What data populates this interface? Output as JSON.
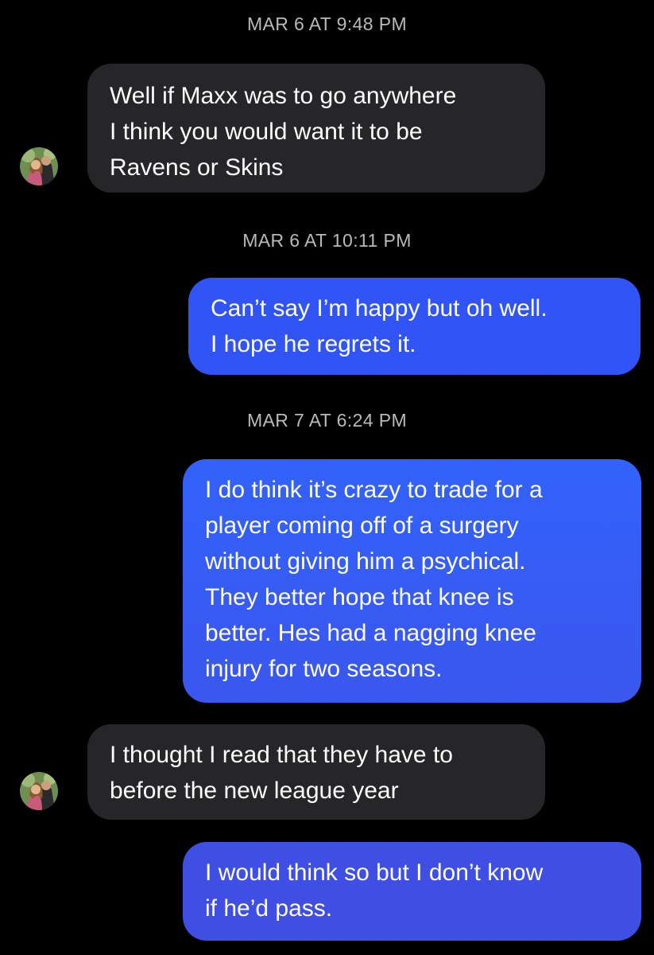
{
  "colors": {
    "background": "#000000",
    "received_bubble": "#262629",
    "sent_bubble_top": "#2f5ef9",
    "sent_bubble_bottom": "#3f4fe3",
    "timestamp_text": "#b9b9be"
  },
  "conversation": {
    "timestamps": [
      "MAR 6 AT 9:48 PM",
      "MAR 6 AT 10:11 PM",
      "MAR 7 AT 6:24 PM"
    ],
    "messages": [
      {
        "direction": "received",
        "avatar": "contact-avatar-photo",
        "text": "Well if Maxx was to go anywhere\nI think you would want it to be\nRavens or Skins"
      },
      {
        "direction": "sent",
        "text": "Can’t say I’m happy but oh well.\nI hope he regrets it."
      },
      {
        "direction": "sent",
        "text": "I do think it’s crazy to trade for a\nplayer coming off of a surgery\nwithout giving him a psychical.\nThey better hope that knee is\nbetter. Hes had a nagging knee\ninjury for two seasons."
      },
      {
        "direction": "received",
        "avatar": "contact-avatar-photo",
        "text": "I thought I read that they have to\nbefore the new league year"
      },
      {
        "direction": "sent",
        "text": "I would think so but I don’t know\nif he’d pass."
      }
    ]
  }
}
